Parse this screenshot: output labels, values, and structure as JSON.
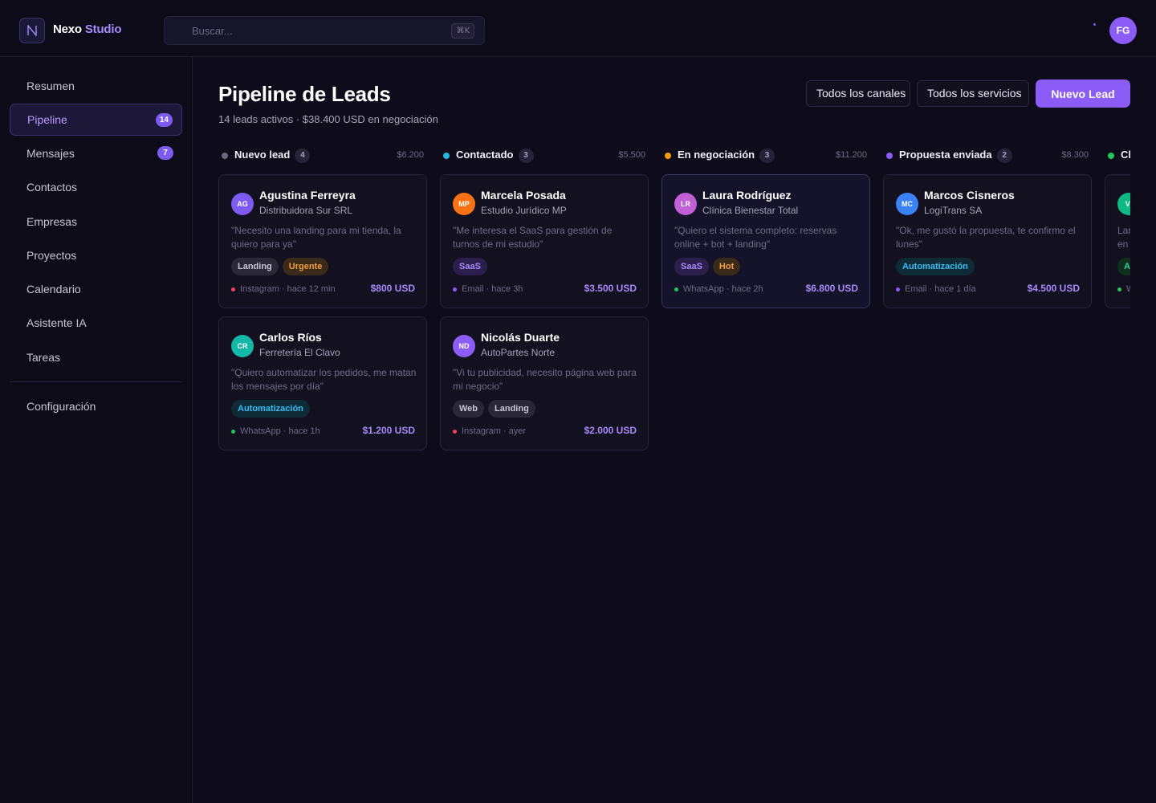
{
  "brand": {
    "name_part1": "Nexo",
    "name_part2": "Studio"
  },
  "search": {
    "placeholder": "Buscar...",
    "shortcut": "⌘K"
  },
  "user": {
    "initials": "FG"
  },
  "sidebar": {
    "items": [
      {
        "label": "Resumen"
      },
      {
        "label": "Pipeline",
        "badge": "14",
        "active": true
      },
      {
        "label": "Mensajes",
        "badge": "7"
      },
      {
        "label": "Contactos"
      },
      {
        "label": "Empresas"
      },
      {
        "label": "Proyectos"
      },
      {
        "label": "Calendario"
      },
      {
        "label": "Asistente IA"
      },
      {
        "label": "Tareas"
      }
    ],
    "settings_label": "Configuración"
  },
  "header": {
    "title": "Pipeline de Leads",
    "subtitle": "14 leads activos · $38.400 USD en negociación",
    "filter_channels": "Todos los canales",
    "filter_services": "Todos los servicios",
    "new_lead_label": "Nuevo Lead"
  },
  "colors": {
    "accent": "#8b5cf6",
    "stage_new": "#6b6880",
    "stage_contacted": "#22b8e0",
    "stage_negotiation": "#f59e0b",
    "stage_proposal": "#8b5cf6",
    "stage_closed": "#22c55e",
    "channel_instagram": "#f43f5e",
    "channel_email": "#8b5cf6",
    "channel_whatsapp": "#22c55e"
  },
  "columns": [
    {
      "title": "Nuevo lead",
      "count": "4",
      "total": "$6.200",
      "cards": [
        {
          "initials": "AG",
          "name": "Agustina Ferreyra",
          "company": "Distribuidora Sur SRL",
          "quote": "\"Necesito una landing para mi tienda, la quiero para ya\"",
          "tags": [
            "Landing",
            "Urgente"
          ],
          "channel": "Instagram · hace 12 min",
          "amount": "$800 USD"
        },
        {
          "initials": "CR",
          "name": "Carlos Ríos",
          "company": "Ferretería El Clavo",
          "quote": "\"Quiero automatizar los pedidos, me matan los mensajes por día\"",
          "tags": [
            "Automatización"
          ],
          "channel": "WhatsApp · hace 1h",
          "amount": "$1.200 USD"
        }
      ]
    },
    {
      "title": "Contactado",
      "count": "3",
      "total": "$5.500",
      "cards": [
        {
          "initials": "MP",
          "name": "Marcela Posada",
          "company": "Estudio Jurídico MP",
          "quote": "\"Me interesa el SaaS para gestión de turnos de mi estudio\"",
          "tags": [
            "SaaS"
          ],
          "channel": "Email · hace 3h",
          "amount": "$3.500 USD"
        },
        {
          "initials": "ND",
          "name": "Nicolás Duarte",
          "company": "AutoPartes Norte",
          "quote": "\"Vi tu publicidad, necesito página web para mi negocio\"",
          "tags": [
            "Web",
            "Landing"
          ],
          "channel": "Instagram · ayer",
          "amount": "$2.000 USD"
        }
      ]
    },
    {
      "title": "En negociación",
      "count": "3",
      "total": "$11.200",
      "cards": [
        {
          "initials": "LR",
          "name": "Laura Rodríguez",
          "company": "Clínica Bienestar Total",
          "quote": "\"Quiero el sistema completo: reservas online + bot + landing\"",
          "tags": [
            "SaaS",
            "Hot"
          ],
          "channel": "WhatsApp · hace 2h",
          "amount": "$6.800 USD"
        }
      ]
    },
    {
      "title": "Propuesta enviada",
      "count": "2",
      "total": "$8.300",
      "cards": [
        {
          "initials": "MC",
          "name": "Marcos Cisneros",
          "company": "LogiTrans SA",
          "quote": "\"Ok, me gustó la propuesta, te confirmo el lunes\"",
          "tags": [
            "Automatización"
          ],
          "channel": "Email · hace 1 día",
          "amount": "$4.500 USD"
        }
      ]
    },
    {
      "title": "Cl",
      "count": "",
      "total": "",
      "cards": [
        {
          "initials": "VI",
          "name": "",
          "company": "",
          "quote": "Lar en",
          "tags": [
            "A"
          ],
          "channel": "W",
          "amount": ""
        }
      ]
    }
  ]
}
